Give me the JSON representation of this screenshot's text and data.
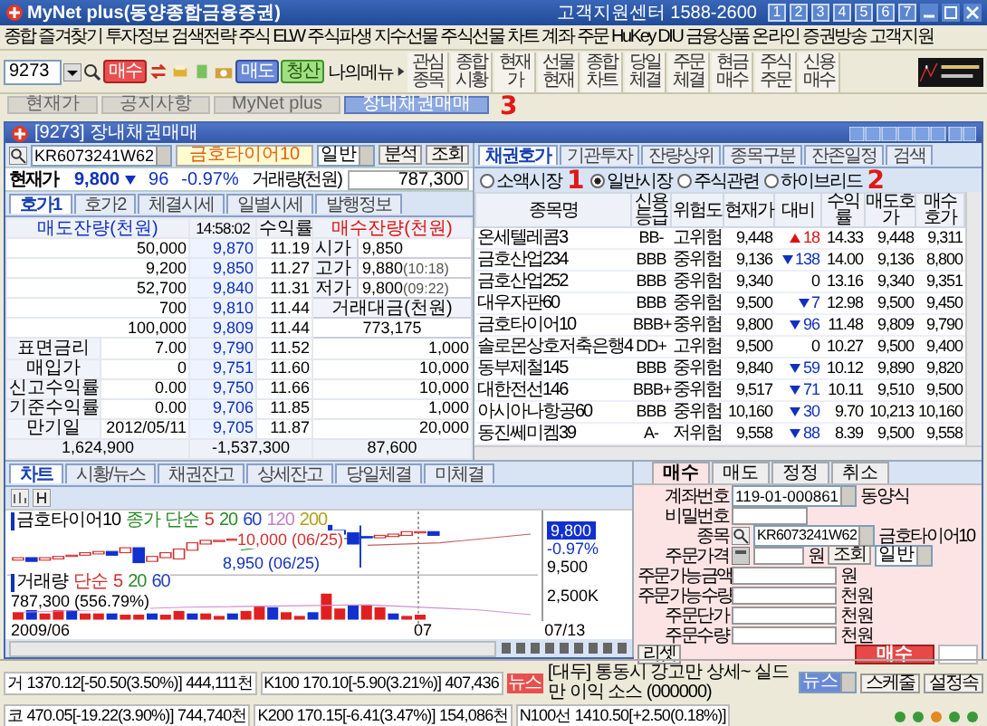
{
  "window": {
    "title": "MyNet plus(동양종합금융증권)",
    "support": "고객지원센터 1588-2600",
    "screen_buttons": [
      "1",
      "2",
      "3",
      "4",
      "5",
      "6",
      "7"
    ]
  },
  "menu": [
    "종합",
    "즐겨찾기",
    "투자정보",
    "검색전략",
    "주식",
    "ELW",
    "주식파생",
    "지수선물",
    "주식선물",
    "차트",
    "계좌",
    "주문",
    "HuKey",
    "DIU",
    "금융상품",
    "온라인",
    "증권방송",
    "고객지원"
  ],
  "toolbar": {
    "screen_code": "9273",
    "buy": "매수",
    "sell": "매도",
    "clear": "청산",
    "my_menu": "나의메뉴",
    "shortcuts": [
      "관심종목",
      "종합시황",
      "현재가",
      "선물현재",
      "종합차트",
      "당일체결",
      "주문체결",
      "현금매수",
      "주식주문",
      "신용매수"
    ]
  },
  "screen_tabs": [
    {
      "label": "현재가",
      "selected": false
    },
    {
      "label": "공지사항",
      "selected": false
    },
    {
      "label": "MyNet plus",
      "selected": false
    },
    {
      "label": "장내채권매매",
      "selected": true
    }
  ],
  "annotations": [
    "1",
    "2",
    "3"
  ],
  "bond_window": {
    "title": "[9273] 장내채권매매",
    "code": "KR6073241W62",
    "name": "금호타이어10",
    "market": "일반",
    "analyze": "분석",
    "query": "조회",
    "price": {
      "label": "현재가",
      "value": "9,800",
      "rising": false,
      "falling": true,
      "change": "96",
      "rate": "-0.97%",
      "volume_label": "거래량(천원)",
      "volume": "787,300"
    },
    "tabs": [
      {
        "label": "호가1",
        "selected": true
      },
      {
        "label": "호가2",
        "selected": false
      },
      {
        "label": "체결시세",
        "selected": false
      },
      {
        "label": "일별시세",
        "selected": false
      },
      {
        "label": "발행정보",
        "selected": false
      }
    ],
    "book": {
      "ask_header": "매도잔량(천원)",
      "time": "14:58:02",
      "yield_header": "수익률",
      "bid_header": "매수잔량(천원)",
      "asks": [
        {
          "qty": "50,000",
          "price": "9,870",
          "yield": "11.19"
        },
        {
          "qty": "9,200",
          "price": "9,850",
          "yield": "11.27"
        },
        {
          "qty": "52,700",
          "price": "9,840",
          "yield": "11.31"
        },
        {
          "qty": "700",
          "price": "9,810",
          "yield": "11.44"
        },
        {
          "qty": "100,000",
          "price": "9,809",
          "yield": "11.44"
        }
      ],
      "bids": [
        {
          "price": "9,790",
          "yield": "11.52",
          "qty": "1,000"
        },
        {
          "price": "9,751",
          "yield": "11.60",
          "qty": "10,000"
        },
        {
          "price": "9,750",
          "yield": "11.66",
          "qty": "10,000"
        },
        {
          "price": "9,706",
          "yield": "11.85",
          "qty": "1,000"
        },
        {
          "price": "9,705",
          "yield": "11.87",
          "qty": "20,000"
        }
      ],
      "stats": [
        {
          "label": "시가",
          "value": "9,850"
        },
        {
          "label": "고가",
          "value": "9,880",
          "time": "(10:18)"
        },
        {
          "label": "저가",
          "value": "9,800",
          "time": "(09:22)"
        }
      ],
      "amount_label": "거래대금(천원)",
      "amount": "773,175",
      "info": [
        {
          "label": "표면금리",
          "value": "7.00"
        },
        {
          "label": "매입가",
          "value": "0"
        },
        {
          "label": "신고수익률",
          "value": "0.00"
        },
        {
          "label": "기준수익률",
          "value": "0.00"
        },
        {
          "label": "만기일",
          "value": "2012/05/11"
        }
      ],
      "totals": [
        "1,624,900",
        "-1,537,300",
        "87,600"
      ]
    },
    "list_tabs": [
      {
        "label": "채권호가",
        "selected": true
      },
      {
        "label": "기관투자",
        "selected": false
      },
      {
        "label": "잔량상위",
        "selected": false
      },
      {
        "label": "종목구분",
        "selected": false
      },
      {
        "label": "잔존일정",
        "selected": false
      },
      {
        "label": "검색",
        "selected": false
      }
    ],
    "markets": [
      {
        "label": "소액시장",
        "selected": false
      },
      {
        "label": "일반시장",
        "selected": true
      },
      {
        "label": "주식관련",
        "selected": false
      },
      {
        "label": "하이브리드",
        "selected": false
      }
    ],
    "columns": [
      "종목명",
      "신용등급",
      "위험도",
      "현재가",
      "대비",
      "수익률",
      "매도호가",
      "매수호가"
    ],
    "rows": [
      {
        "name": "온세텔레콤3",
        "grade": "BB-",
        "risk": "고위험",
        "price": "9,448",
        "rising": true,
        "falling": false,
        "change": "18",
        "yield": "14.33",
        "ask": "9,448",
        "bid": "9,311"
      },
      {
        "name": "금호산업234",
        "grade": "BBB",
        "risk": "중위험",
        "price": "9,136",
        "rising": false,
        "falling": true,
        "change": "138",
        "yield": "14.00",
        "ask": "9,136",
        "bid": "8,800"
      },
      {
        "name": "금호산업252",
        "grade": "BBB",
        "risk": "중위험",
        "price": "9,340",
        "rising": false,
        "falling": false,
        "change": "0",
        "yield": "13.16",
        "ask": "9,340",
        "bid": "9,351"
      },
      {
        "name": "대우자판60",
        "grade": "BBB",
        "risk": "중위험",
        "price": "9,500",
        "rising": false,
        "falling": true,
        "change": "7",
        "yield": "12.98",
        "ask": "9,500",
        "bid": "9,450"
      },
      {
        "name": "금호타이어10",
        "grade": "BBB+",
        "risk": "중위험",
        "price": "9,800",
        "rising": false,
        "falling": true,
        "change": "96",
        "yield": "11.48",
        "ask": "9,809",
        "bid": "9,790"
      },
      {
        "name": "솔로몬상호저축은행4",
        "grade": "DD+",
        "risk": "고위험",
        "price": "9,500",
        "rising": false,
        "falling": false,
        "change": "0",
        "yield": "10.27",
        "ask": "9,500",
        "bid": "9,400"
      },
      {
        "name": "동부제철145",
        "grade": "BBB",
        "risk": "중위험",
        "price": "9,840",
        "rising": false,
        "falling": true,
        "change": "59",
        "yield": "10.12",
        "ask": "9,890",
        "bid": "9,820"
      },
      {
        "name": "대한전선146",
        "grade": "BBB+",
        "risk": "중위험",
        "price": "9,517",
        "rising": false,
        "falling": true,
        "change": "71",
        "yield": "10.11",
        "ask": "9,510",
        "bid": "9,500"
      },
      {
        "name": "아시아나항공60",
        "grade": "BBB",
        "risk": "중위험",
        "price": "10,160",
        "rising": false,
        "falling": true,
        "change": "30",
        "yield": "9.70",
        "ask": "10,213",
        "bid": "10,160"
      },
      {
        "name": "동진쎄미켐39",
        "grade": "A-",
        "risk": "저위험",
        "price": "9,558",
        "rising": false,
        "falling": true,
        "change": "88",
        "yield": "8.39",
        "ask": "9,500",
        "bid": "9,558"
      }
    ]
  },
  "bottom_tabs": [
    {
      "label": "차트",
      "selected": true
    },
    {
      "label": "시황/뉴스",
      "selected": false
    },
    {
      "label": "채권잔고",
      "selected": false
    },
    {
      "label": "상세잔고",
      "selected": false
    },
    {
      "label": "당일체결",
      "selected": false
    },
    {
      "label": "미체결",
      "selected": false
    }
  ],
  "chart": {
    "name": "금호타이어10",
    "legend_label": "종가 단순",
    "legend": [
      {
        "label": "5",
        "color": "#d03030"
      },
      {
        "label": "20",
        "color": "#2a8a2a"
      },
      {
        "label": "60",
        "color": "#2040c0"
      },
      {
        "label": "120",
        "color": "#c080c0"
      },
      {
        "label": "200",
        "color": "#b0a020"
      }
    ],
    "high_note": "10,000 (06/25)",
    "low_note": "8,950 (06/25)",
    "last": "9,800",
    "rate": "-0.97%",
    "axis_price": "9,500",
    "volume_label": "거래량",
    "volume_legend_label": "단순",
    "volume_legend": [
      {
        "label": "5",
        "color": "#d03030"
      },
      {
        "label": "20",
        "color": "#2a8a2a"
      },
      {
        "label": "60",
        "color": "#2040c0"
      }
    ],
    "volume_note": "787,300 (556.79%)",
    "axis_volume": "2,500K",
    "x_labels": [
      "2009/06",
      "07",
      "07/13"
    ]
  },
  "order": {
    "tabs": [
      {
        "label": "매수",
        "selected": true
      },
      {
        "label": "매도",
        "selected": false
      },
      {
        "label": "정정",
        "selected": false
      },
      {
        "label": "취소",
        "selected": false
      }
    ],
    "account_label": "계좌번호",
    "account": "119-01-000861",
    "owner": "동양식",
    "password_label": "비밀번호",
    "item_label": "종목",
    "code": "KR6073241W62",
    "name": "금호타이어10",
    "price_label": "주문가격",
    "price_unit": "원",
    "query": "조회",
    "type": "일반",
    "fields": [
      {
        "label": "주문가능금액",
        "unit": "원"
      },
      {
        "label": "주문가능수량",
        "unit": "천원"
      },
      {
        "label": "주문단가",
        "unit": "천원"
      },
      {
        "label": "주문수량",
        "unit": "천원"
      }
    ],
    "reset": "리셋",
    "submit": "매수"
  },
  "status": {
    "row1": [
      "거 1370.12[-50.50(3.50%)] 444,111천",
      "K100 170.10[-5.90(3.21%)] 407,436"
    ],
    "news_badge": "뉴스",
    "headline": "[대두] 통동시 강고만 상세~ 실드만 이익 소스 (000000)",
    "row2": [
      "코 470.05[-19.22(3.90%)] 744,740천",
      "K200 170.15[-6.41(3.47%)] 154,086천",
      "N100선 1410.50[+2.50(0.18%)]"
    ],
    "news_select": "뉴스",
    "buttons": [
      "스케줄",
      "설정속"
    ]
  }
}
